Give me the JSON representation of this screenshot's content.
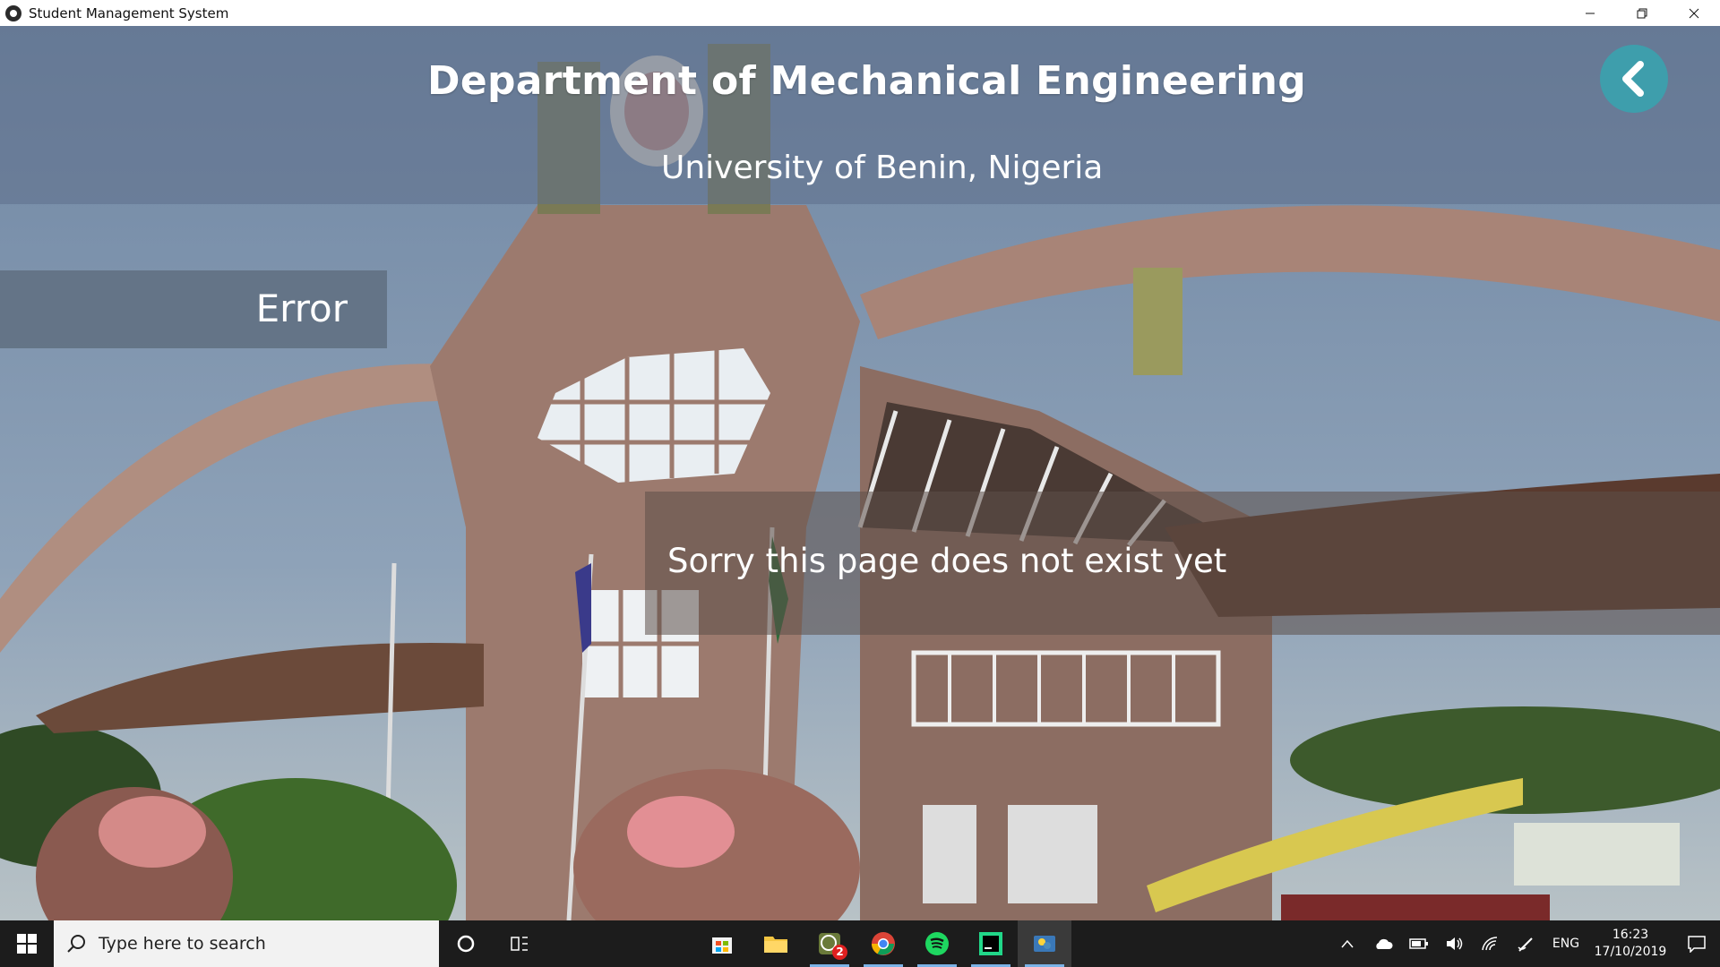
{
  "window": {
    "title": "Student Management System"
  },
  "header": {
    "title": "Department of Mechanical Engineering",
    "subtitle": "University of Benin, Nigeria"
  },
  "error_panel": {
    "label": "Error"
  },
  "message": {
    "text": "Sorry this page does not exist yet"
  },
  "colors": {
    "back_button": "#3e9eac",
    "taskbar": "#1c1c1c"
  },
  "taskbar": {
    "search_placeholder": "Type here to search",
    "apps": [
      {
        "name": "microsoft-store-icon"
      },
      {
        "name": "file-explorer-icon"
      },
      {
        "name": "whatsapp-icon",
        "badge": "2"
      },
      {
        "name": "chrome-icon"
      },
      {
        "name": "spotify-icon"
      },
      {
        "name": "pycharm-icon"
      },
      {
        "name": "python-app-icon"
      }
    ],
    "language": "ENG",
    "time": "16:23",
    "date": "17/10/2019"
  }
}
